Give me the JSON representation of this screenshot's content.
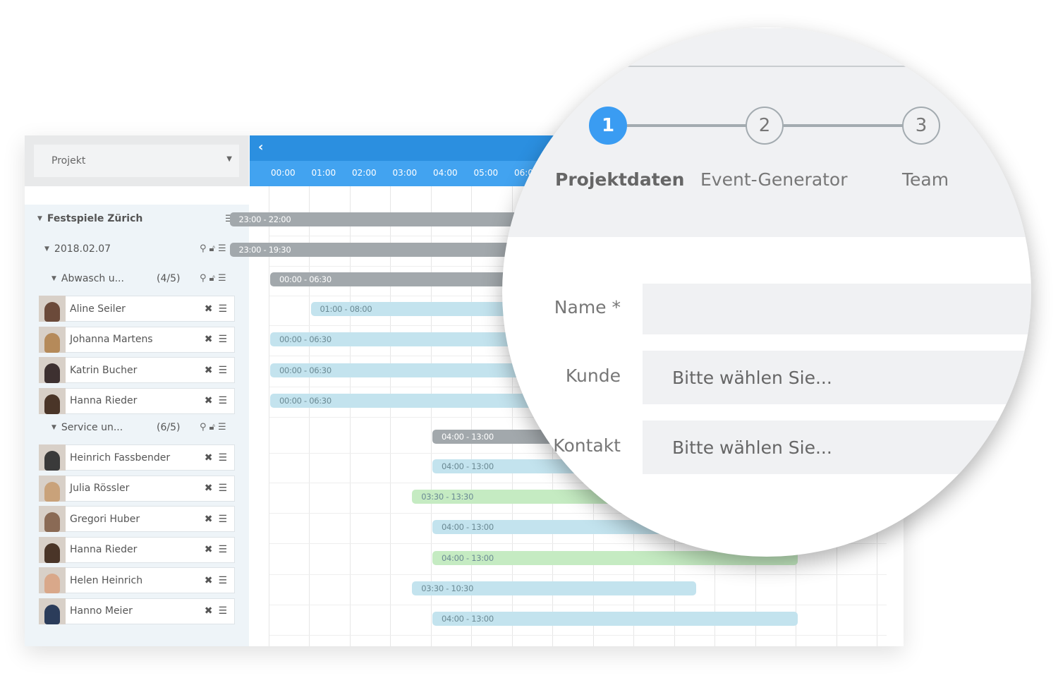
{
  "sidebar": {
    "project_select": "Projekt",
    "project": "Festspiele Zürich",
    "date": "2018.02.07",
    "groups": [
      {
        "label": "Abwasch u...",
        "count": "(4/5)",
        "people": [
          "Aline Seiler",
          "Johanna Martens",
          "Katrin Bucher",
          "Hanna Rieder"
        ]
      },
      {
        "label": "Service un...",
        "count": "(6/5)",
        "people": [
          "Heinrich Fassbender",
          "Julia Rössler",
          "Gregori Huber",
          "Hanna Rieder",
          "Helen Heinrich",
          "Hanno Meier"
        ]
      }
    ]
  },
  "timeline": {
    "hours": [
      "00:00",
      "01:00",
      "02:00",
      "03:00",
      "04:00",
      "05:00",
      "06:00"
    ],
    "bars": [
      {
        "label": "23:00 - 22:00",
        "start": -1,
        "end": 22,
        "type": "gray"
      },
      {
        "label": "23:00 - 19:30",
        "start": -1,
        "end": 19.5,
        "type": "gray"
      },
      {
        "label": "00:00 - 06:30",
        "start": 0,
        "end": 6.5,
        "type": "gray"
      },
      {
        "label": "01:00 - 08:00",
        "start": 1,
        "end": 8,
        "type": "blue"
      },
      {
        "label": "00:00 - 06:30",
        "start": 0,
        "end": 6.5,
        "type": "blue"
      },
      {
        "label": "00:00 - 06:30",
        "start": 0,
        "end": 6.5,
        "type": "blue"
      },
      {
        "label": "00:00 - 06:30",
        "start": 0,
        "end": 6.5,
        "type": "blue"
      },
      {
        "label": "04:00 - 13:00",
        "start": 4,
        "end": 13,
        "type": "gray"
      },
      {
        "label": "04:00 - 13:00",
        "start": 4,
        "end": 13,
        "type": "blue"
      },
      {
        "label": "03:30 - 13:30",
        "start": 3.5,
        "end": 13.5,
        "type": "green"
      },
      {
        "label": "04:00 - 13:00",
        "start": 4,
        "end": 13,
        "type": "blue"
      },
      {
        "label": "04:00 - 13:00",
        "start": 4,
        "end": 13,
        "type": "green"
      },
      {
        "label": "03:30 - 10:30",
        "start": 3.5,
        "end": 10.5,
        "type": "blue"
      },
      {
        "label": "04:00 - 13:00",
        "start": 4,
        "end": 13,
        "type": "blue"
      }
    ]
  },
  "colors": {
    "gray": "#a2a8ac",
    "blue": "#c3e3ee",
    "green": "#c5ebc2",
    "accent": "#3a9cf2"
  },
  "wizard": {
    "steps": [
      {
        "num": "1",
        "label": "Projektdaten",
        "active": true
      },
      {
        "num": "2",
        "label": "Event-Generator"
      },
      {
        "num": "3",
        "label": "Team"
      }
    ],
    "fields": [
      {
        "label": "Name *",
        "value": ""
      },
      {
        "label": "Kunde",
        "value": "Bitte wählen Sie..."
      },
      {
        "label": "Kontakt",
        "value": "Bitte wählen Sie..."
      }
    ]
  }
}
